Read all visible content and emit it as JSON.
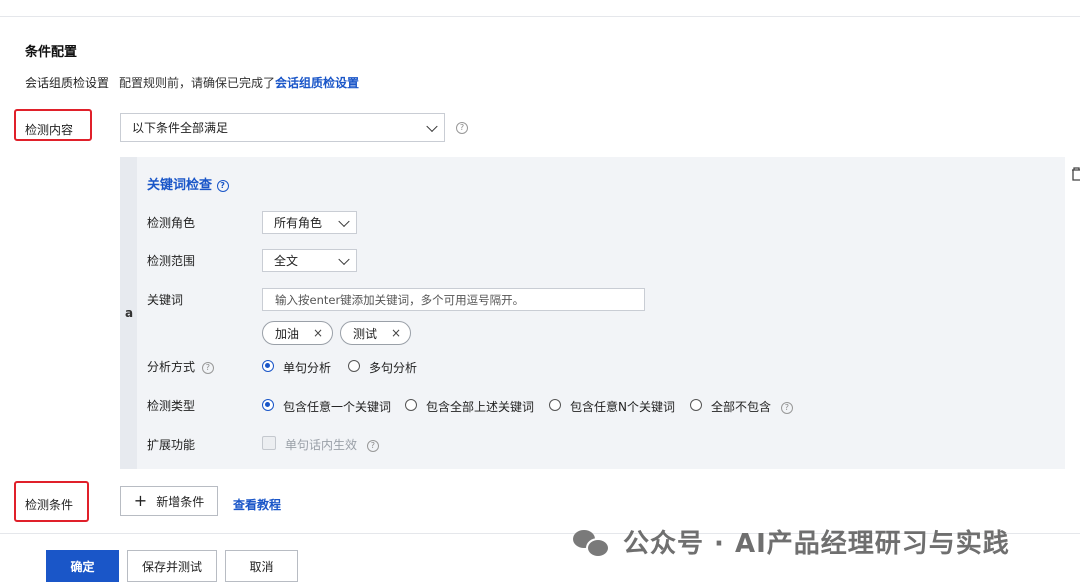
{
  "section": {
    "title": "条件配置"
  },
  "session_setting": {
    "label": "会话组质检设置",
    "note_prefix": "配置规则前，请确保已完成了",
    "note_link": "会话组质检设置"
  },
  "detect_content": {
    "label": "检测内容",
    "select_value": "以下条件全部满足",
    "help": "?"
  },
  "condition": {
    "index": "a",
    "title": "关键词检查",
    "title_help": "?",
    "role": {
      "label": "检测角色",
      "value": "所有角色"
    },
    "scope": {
      "label": "检测范围",
      "value": "全文"
    },
    "keywords": {
      "label": "关键词",
      "placeholder": "输入按enter键添加关键词，多个可用逗号隔开。",
      "tags": [
        {
          "text": "加油",
          "remove": "×"
        },
        {
          "text": "测试",
          "remove": "×"
        }
      ]
    },
    "analysis": {
      "label": "分析方式",
      "help": "?",
      "options": [
        "单句分析",
        "多句分析"
      ],
      "selected": "单句分析"
    },
    "detect_type": {
      "label": "检测类型",
      "options": [
        "包含任意一个关键词",
        "包含全部上述关键词",
        "包含任意N个关键词",
        "全部不包含"
      ],
      "selected": "包含任意一个关键词",
      "help": "?"
    },
    "extension": {
      "label": "扩展功能",
      "checkbox_label": "单句话内生效",
      "checked": false,
      "help": "?"
    }
  },
  "detect_condition": {
    "label": "检测条件",
    "add_button": "新增条件",
    "add_icon": "+",
    "tutorial_link": "查看教程"
  },
  "footer": {
    "confirm": "确定",
    "save_test": "保存并测试",
    "cancel": "取消"
  },
  "watermark": {
    "text": "公众号 · AI产品经理研习与实践",
    "icon": "wechat-icon"
  },
  "colors": {
    "accent": "#1a56c8",
    "annotation_red": "#e0202a",
    "panel_bg": "#f2f4f7"
  }
}
